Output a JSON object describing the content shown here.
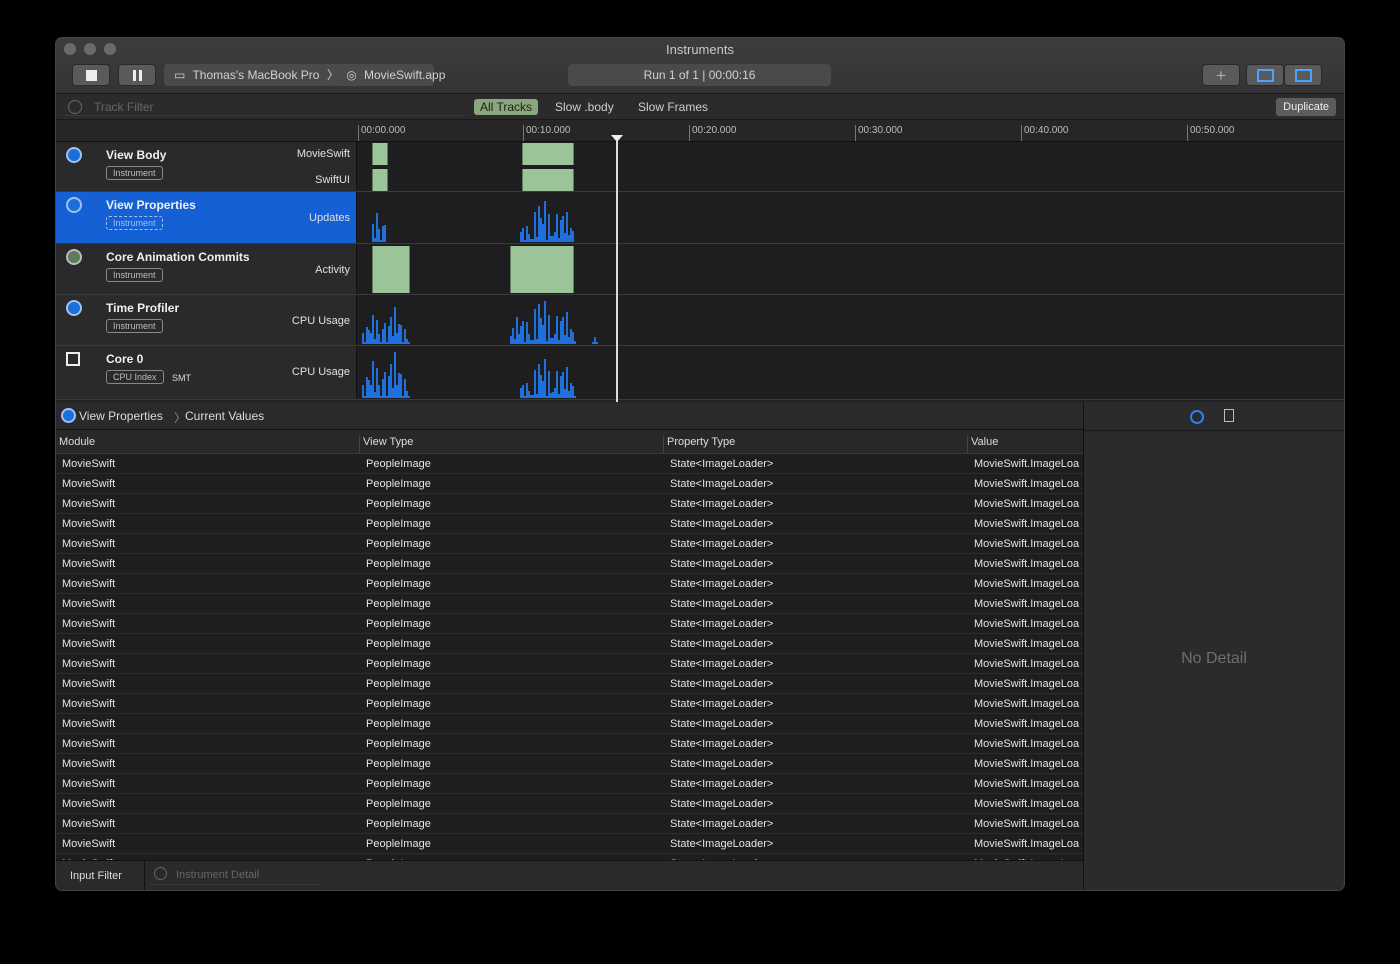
{
  "window": {
    "title": "Instruments"
  },
  "toolbar": {
    "device": "Thomas's MacBook Pro",
    "app": "MovieSwift.app",
    "run": "Run 1 of 1  |  00:00:16"
  },
  "filter": {
    "placeholder": "Track Filter",
    "tabs": [
      "All Tracks",
      "Slow .body",
      "Slow Frames"
    ],
    "duplicate": "Duplicate"
  },
  "ruler": {
    "ticks": [
      "00:00.000",
      "00:10.000",
      "00:20.000",
      "00:30.000",
      "00:40.000",
      "00:50.000"
    ]
  },
  "tracks": [
    {
      "name": "View Body",
      "badge": "Instrument",
      "subs": [
        "MovieSwift",
        "SwiftUI"
      ],
      "selected": false
    },
    {
      "name": "View Properties",
      "badge": "Instrument",
      "subs": [
        "Updates"
      ],
      "selected": true
    },
    {
      "name": "Core Animation Commits",
      "badge": "Instrument",
      "subs": [
        "Activity"
      ],
      "selected": false
    },
    {
      "name": "Time Profiler",
      "badge": "Instrument",
      "subs": [
        "CPU Usage"
      ],
      "selected": false
    },
    {
      "name": "Core 0",
      "badge": "CPU Index",
      "extra": "SMT",
      "subs": [
        "CPU Usage"
      ],
      "selected": false
    }
  ],
  "detail": {
    "crumb1": "View Properties",
    "crumb2": "Current Values",
    "columns": [
      "Module",
      "View Type",
      "Property Type",
      "Value"
    ],
    "row": {
      "module": "MovieSwift",
      "view_type": "PeopleImage",
      "property_type": "State<ImageLoader>",
      "value": "MovieSwift.ImageLoa"
    },
    "row_count": 21
  },
  "status": {
    "input_filter": "Input Filter",
    "instrument_detail": "Instrument Detail"
  },
  "inspector": {
    "empty": "No Detail"
  },
  "colors": {
    "accent": "#1560d4",
    "activity": "#9bc499",
    "cpu": "#1e70df"
  }
}
